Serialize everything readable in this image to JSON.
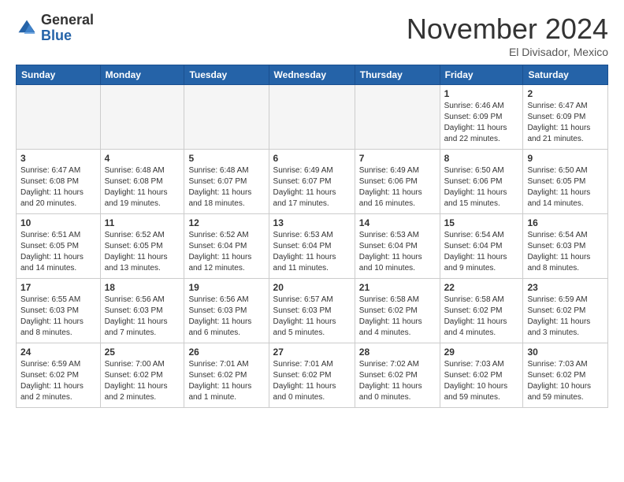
{
  "header": {
    "logo_general": "General",
    "logo_blue": "Blue",
    "month_title": "November 2024",
    "location": "El Divisador, Mexico"
  },
  "weekdays": [
    "Sunday",
    "Monday",
    "Tuesday",
    "Wednesday",
    "Thursday",
    "Friday",
    "Saturday"
  ],
  "weeks": [
    [
      {
        "day": "",
        "info": ""
      },
      {
        "day": "",
        "info": ""
      },
      {
        "day": "",
        "info": ""
      },
      {
        "day": "",
        "info": ""
      },
      {
        "day": "",
        "info": ""
      },
      {
        "day": "1",
        "info": "Sunrise: 6:46 AM\nSunset: 6:09 PM\nDaylight: 11 hours and 22 minutes."
      },
      {
        "day": "2",
        "info": "Sunrise: 6:47 AM\nSunset: 6:09 PM\nDaylight: 11 hours and 21 minutes."
      }
    ],
    [
      {
        "day": "3",
        "info": "Sunrise: 6:47 AM\nSunset: 6:08 PM\nDaylight: 11 hours and 20 minutes."
      },
      {
        "day": "4",
        "info": "Sunrise: 6:48 AM\nSunset: 6:08 PM\nDaylight: 11 hours and 19 minutes."
      },
      {
        "day": "5",
        "info": "Sunrise: 6:48 AM\nSunset: 6:07 PM\nDaylight: 11 hours and 18 minutes."
      },
      {
        "day": "6",
        "info": "Sunrise: 6:49 AM\nSunset: 6:07 PM\nDaylight: 11 hours and 17 minutes."
      },
      {
        "day": "7",
        "info": "Sunrise: 6:49 AM\nSunset: 6:06 PM\nDaylight: 11 hours and 16 minutes."
      },
      {
        "day": "8",
        "info": "Sunrise: 6:50 AM\nSunset: 6:06 PM\nDaylight: 11 hours and 15 minutes."
      },
      {
        "day": "9",
        "info": "Sunrise: 6:50 AM\nSunset: 6:05 PM\nDaylight: 11 hours and 14 minutes."
      }
    ],
    [
      {
        "day": "10",
        "info": "Sunrise: 6:51 AM\nSunset: 6:05 PM\nDaylight: 11 hours and 14 minutes."
      },
      {
        "day": "11",
        "info": "Sunrise: 6:52 AM\nSunset: 6:05 PM\nDaylight: 11 hours and 13 minutes."
      },
      {
        "day": "12",
        "info": "Sunrise: 6:52 AM\nSunset: 6:04 PM\nDaylight: 11 hours and 12 minutes."
      },
      {
        "day": "13",
        "info": "Sunrise: 6:53 AM\nSunset: 6:04 PM\nDaylight: 11 hours and 11 minutes."
      },
      {
        "day": "14",
        "info": "Sunrise: 6:53 AM\nSunset: 6:04 PM\nDaylight: 11 hours and 10 minutes."
      },
      {
        "day": "15",
        "info": "Sunrise: 6:54 AM\nSunset: 6:04 PM\nDaylight: 11 hours and 9 minutes."
      },
      {
        "day": "16",
        "info": "Sunrise: 6:54 AM\nSunset: 6:03 PM\nDaylight: 11 hours and 8 minutes."
      }
    ],
    [
      {
        "day": "17",
        "info": "Sunrise: 6:55 AM\nSunset: 6:03 PM\nDaylight: 11 hours and 8 minutes."
      },
      {
        "day": "18",
        "info": "Sunrise: 6:56 AM\nSunset: 6:03 PM\nDaylight: 11 hours and 7 minutes."
      },
      {
        "day": "19",
        "info": "Sunrise: 6:56 AM\nSunset: 6:03 PM\nDaylight: 11 hours and 6 minutes."
      },
      {
        "day": "20",
        "info": "Sunrise: 6:57 AM\nSunset: 6:03 PM\nDaylight: 11 hours and 5 minutes."
      },
      {
        "day": "21",
        "info": "Sunrise: 6:58 AM\nSunset: 6:02 PM\nDaylight: 11 hours and 4 minutes."
      },
      {
        "day": "22",
        "info": "Sunrise: 6:58 AM\nSunset: 6:02 PM\nDaylight: 11 hours and 4 minutes."
      },
      {
        "day": "23",
        "info": "Sunrise: 6:59 AM\nSunset: 6:02 PM\nDaylight: 11 hours and 3 minutes."
      }
    ],
    [
      {
        "day": "24",
        "info": "Sunrise: 6:59 AM\nSunset: 6:02 PM\nDaylight: 11 hours and 2 minutes."
      },
      {
        "day": "25",
        "info": "Sunrise: 7:00 AM\nSunset: 6:02 PM\nDaylight: 11 hours and 2 minutes."
      },
      {
        "day": "26",
        "info": "Sunrise: 7:01 AM\nSunset: 6:02 PM\nDaylight: 11 hours and 1 minute."
      },
      {
        "day": "27",
        "info": "Sunrise: 7:01 AM\nSunset: 6:02 PM\nDaylight: 11 hours and 0 minutes."
      },
      {
        "day": "28",
        "info": "Sunrise: 7:02 AM\nSunset: 6:02 PM\nDaylight: 11 hours and 0 minutes."
      },
      {
        "day": "29",
        "info": "Sunrise: 7:03 AM\nSunset: 6:02 PM\nDaylight: 10 hours and 59 minutes."
      },
      {
        "day": "30",
        "info": "Sunrise: 7:03 AM\nSunset: 6:02 PM\nDaylight: 10 hours and 59 minutes."
      }
    ]
  ]
}
